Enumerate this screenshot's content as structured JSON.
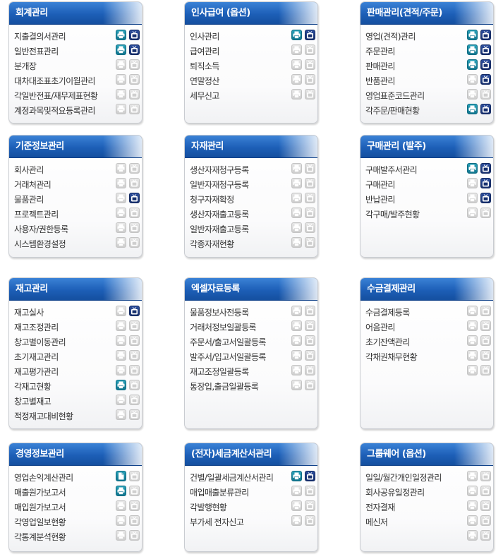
{
  "colors": {
    "header_blue": "#1d5fb7",
    "icon_active_teal": "#11768f",
    "icon_active_navy": "#17306e",
    "icon_inactive": "#cdcdcd"
  },
  "panels": [
    {
      "title": "회계관리",
      "items": [
        {
          "label": "지출결의서관리",
          "print": "active",
          "tv": "active"
        },
        {
          "label": "일반전표관리",
          "print": "active",
          "tv": "active"
        },
        {
          "label": "분개장",
          "print": "inactive",
          "tv": "inactive"
        },
        {
          "label": "대차대조표초기이월관리",
          "print": "inactive",
          "tv": "inactive"
        },
        {
          "label": "각일반전표/재무제표현황",
          "print": "inactive",
          "tv": "inactive"
        },
        {
          "label": "계정과목및적요등록관리",
          "print": "inactive",
          "tv": "inactive"
        }
      ]
    },
    {
      "title": "인사급여 (옵션)",
      "items": [
        {
          "label": "인사관리",
          "print": "active",
          "tv": "active"
        },
        {
          "label": "급여관리",
          "print": "inactive",
          "tv": "inactive"
        },
        {
          "label": "퇴직소득",
          "print": "inactive",
          "tv": "inactive"
        },
        {
          "label": "연말정산",
          "print": "inactive",
          "tv": "inactive"
        },
        {
          "label": "세무신고",
          "print": "inactive",
          "tv": "inactive"
        }
      ]
    },
    {
      "title": "판매관리(견적/주문)",
      "items": [
        {
          "label": "영업(견적)관리",
          "print": "active",
          "tv": "active"
        },
        {
          "label": "주문관리",
          "print": "active",
          "tv": "active"
        },
        {
          "label": "판매관리",
          "print": "active",
          "tv": "active"
        },
        {
          "label": "반품관리",
          "print": "inactive",
          "tv": "active"
        },
        {
          "label": "영업표준코드관리",
          "print": "inactive",
          "tv": "inactive"
        },
        {
          "label": "각주문/판매현황",
          "print": "active",
          "tv": "active"
        }
      ]
    },
    {
      "title": "기준정보관리",
      "items": [
        {
          "label": "회사관리",
          "print": "inactive",
          "tv": "inactive"
        },
        {
          "label": "거래처관리",
          "print": "inactive",
          "tv": "inactive"
        },
        {
          "label": "물품관리",
          "print": "inactive",
          "tv": "active"
        },
        {
          "label": "프로젝트관리",
          "print": "inactive",
          "tv": "inactive"
        },
        {
          "label": "사용자/권한등록",
          "print": "inactive",
          "tv": "inactive"
        },
        {
          "label": "시스템환경설정",
          "print": "inactive",
          "tv": "inactive"
        }
      ]
    },
    {
      "title": "자재관리",
      "items": [
        {
          "label": "생산자재청구등록",
          "print": "inactive",
          "tv": "inactive"
        },
        {
          "label": "일반자재청구등록",
          "print": "inactive",
          "tv": "inactive"
        },
        {
          "label": "청구자재확정",
          "print": "inactive",
          "tv": "inactive"
        },
        {
          "label": "생산자재출고등록",
          "print": "inactive",
          "tv": "inactive"
        },
        {
          "label": "일반자재출고등록",
          "print": "inactive",
          "tv": "inactive"
        },
        {
          "label": "각종자재현황",
          "print": "inactive",
          "tv": "inactive"
        }
      ]
    },
    {
      "title": "구매관리 (발주)",
      "items": [
        {
          "label": "구매발주서관리",
          "print": "active",
          "tv": "active"
        },
        {
          "label": "구매관리",
          "print": "inactive",
          "tv": "active"
        },
        {
          "label": "반납관리",
          "print": "inactive",
          "tv": "active"
        },
        {
          "label": "각구매/발주현황",
          "print": "inactive",
          "tv": "inactive"
        }
      ]
    },
    {
      "title": "재고관리",
      "items": [
        {
          "label": "재고실사",
          "print": "inactive",
          "tv": "active"
        },
        {
          "label": "재고조정관리",
          "print": "inactive",
          "tv": "inactive"
        },
        {
          "label": "창고별이동관리",
          "print": "inactive",
          "tv": "inactive"
        },
        {
          "label": "초기재고관리",
          "print": "inactive",
          "tv": "inactive"
        },
        {
          "label": "재고평가관리",
          "print": "inactive",
          "tv": "inactive"
        },
        {
          "label": "각재고현황",
          "print": "active",
          "tv": "inactive"
        },
        {
          "label": "창고별재고",
          "print": "inactive",
          "tv": "inactive"
        },
        {
          "label": "적정재고대비현황",
          "print": "inactive",
          "tv": "inactive"
        }
      ]
    },
    {
      "title": "엑셀자료등록",
      "items": [
        {
          "label": "물품정보사전등록",
          "print": "inactive",
          "tv": "inactive"
        },
        {
          "label": "거래처정보일괄등록",
          "print": "inactive",
          "tv": "inactive"
        },
        {
          "label": "주문서/출고서일괄등록",
          "print": "inactive",
          "tv": "inactive"
        },
        {
          "label": "발주서/입고서일괄등록",
          "print": "inactive",
          "tv": "inactive"
        },
        {
          "label": "재고조정일괄등록",
          "print": "inactive",
          "tv": "inactive"
        },
        {
          "label": "통장입,출금일괄등록",
          "print": "inactive",
          "tv": "inactive"
        }
      ]
    },
    {
      "title": "수금결제관리",
      "items": [
        {
          "label": "수금결제등록",
          "print": "inactive",
          "tv": "inactive"
        },
        {
          "label": "어음관리",
          "print": "inactive",
          "tv": "inactive"
        },
        {
          "label": "초기잔액관리",
          "print": "inactive",
          "tv": "inactive"
        },
        {
          "label": "각채권채무현황",
          "print": "inactive",
          "tv": "inactive"
        },
        {
          "label": "",
          "print": "inactive",
          "tv": "inactive"
        }
      ]
    },
    {
      "title": "경영정보관리",
      "items": [
        {
          "label": "영업손익계산관리",
          "print": "active-doc",
          "tv": "inactive"
        },
        {
          "label": "매출원가보고서",
          "print": "active",
          "tv": "inactive"
        },
        {
          "label": "매입원가보고서",
          "print": "inactive",
          "tv": "inactive"
        },
        {
          "label": "각영업일보현황",
          "print": "inactive",
          "tv": "inactive"
        },
        {
          "label": "각통계분석현황",
          "print": "inactive",
          "tv": "inactive"
        }
      ]
    },
    {
      "title": "(전자)세금계산서관리",
      "items": [
        {
          "label": "건별/일괄세금계산서관리",
          "print": "active",
          "tv": "active"
        },
        {
          "label": "매입매출분류관리",
          "print": "inactive",
          "tv": "inactive"
        },
        {
          "label": "각발행현황",
          "print": "inactive",
          "tv": "inactive"
        },
        {
          "label": "부가세 전자신고",
          "print": "inactive",
          "tv": "inactive"
        }
      ]
    },
    {
      "title": "그룹웨어 (옵션)",
      "items": [
        {
          "label": "일일/월간개인일정관리",
          "print": "inactive",
          "tv": "inactive"
        },
        {
          "label": "회사공유일정관리",
          "print": "inactive",
          "tv": "inactive"
        },
        {
          "label": "전자결재",
          "print": "inactive",
          "tv": "inactive"
        },
        {
          "label": "메신저",
          "print": "inactive",
          "tv": "inactive"
        },
        {
          "label": "",
          "print": "inactive",
          "tv": "inactive"
        }
      ]
    }
  ]
}
